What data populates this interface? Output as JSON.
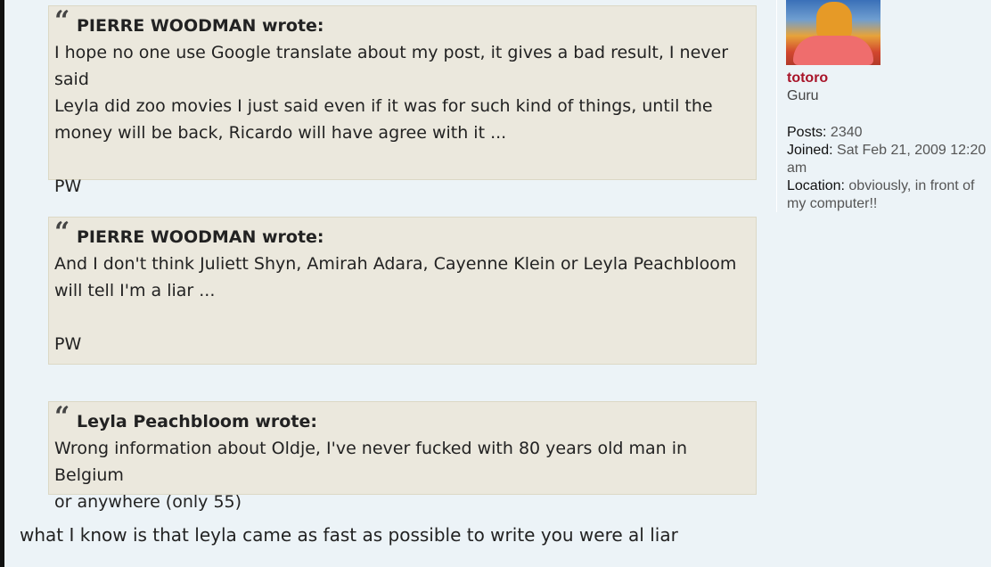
{
  "quotes": [
    {
      "author": "PIERRE WOODMAN wrote:",
      "lines": [
        "I hope no one use Google translate about my post, it gives a bad result, I never said",
        "Leyla did zoo movies I just said even if it was for such kind of things, until the",
        "money will be back, Ricardo will have agree with it ..."
      ],
      "signoff": "PW"
    },
    {
      "author": "PIERRE WOODMAN wrote:",
      "lines": [
        "And I don't think Juliett Shyn, Amirah Adara, Cayenne Klein or Leyla Peachbloom",
        "will tell I'm a liar ..."
      ],
      "signoff": "PW"
    },
    {
      "author": "Leyla Peachbloom wrote:",
      "lines": [
        "Wrong information about Oldje, I've never fucked with 80 years old man in Belgium",
        "or anywhere (only 55)"
      ]
    }
  ],
  "quote_icon": "“",
  "reply_text": "what I know is that leyla came as fast as possible to write you were al liar",
  "profile": {
    "username": "totoro",
    "rank": "Guru",
    "posts_label": "Posts:",
    "posts": "2340",
    "joined_label": "Joined:",
    "joined": "Sat Feb 21, 2009 12:20 am",
    "location_label": "Location:",
    "location": "obviously, in front of my computer!!"
  },
  "colors": {
    "username": "#a81429",
    "quote_bg": "#ebe8dd",
    "post_bg": "#ecf3f7"
  }
}
